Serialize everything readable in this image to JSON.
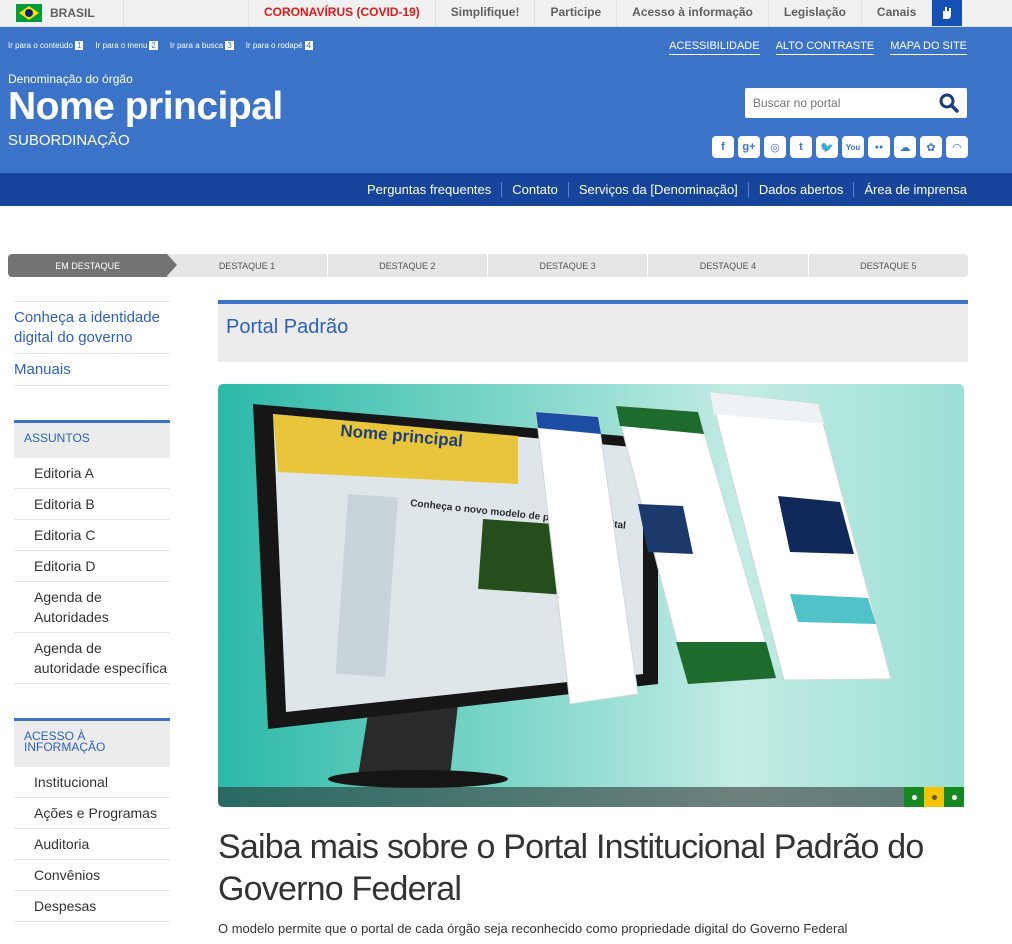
{
  "govbar": {
    "country": "BRASIL",
    "links": [
      "CORONAVÍRUS (COVID-19)",
      "Simplifique!",
      "Participe",
      "Acesso à informação",
      "Legislação",
      "Canais"
    ]
  },
  "access_links": [
    {
      "label": "Ir para o conteúdo",
      "key": "1"
    },
    {
      "label": "Ir para o menu",
      "key": "2"
    },
    {
      "label": "Ir para a busca",
      "key": "3"
    },
    {
      "label": "Ir para o rodapé",
      "key": "4"
    }
  ],
  "tools": [
    "ACESSIBILIDADE",
    "ALTO CONTRASTE",
    "MAPA DO SITE"
  ],
  "header": {
    "denomination": "Denominação do órgão",
    "title": "Nome principal",
    "subordination": "SUBORDINAÇÃO"
  },
  "search": {
    "placeholder": "Buscar no portal"
  },
  "social": [
    "facebook-icon",
    "google-plus-icon",
    "instagram-icon",
    "tumblr-icon",
    "twitter-icon",
    "youtube-icon",
    "flickr-icon",
    "soundcloud-icon",
    "slideshare-icon",
    "rss-icon"
  ],
  "social_glyphs": [
    "f",
    "g+",
    "◎",
    "t",
    "🐦",
    "You",
    "●●",
    "☁",
    "✿",
    "◠"
  ],
  "nav": [
    "Perguntas frequentes",
    "Contato",
    "Serviços da [Denominação]",
    "Dados abertos",
    "Área de imprensa"
  ],
  "highlights": [
    "EM DESTAQUE",
    "DESTAQUE 1",
    "DESTAQUE 2",
    "DESTAQUE 3",
    "DESTAQUE 4",
    "DESTAQUE 5"
  ],
  "sidebar": {
    "top_links": [
      "Conheça a identidade digital do governo",
      "Manuais"
    ],
    "sections": [
      {
        "title": "ASSUNTOS",
        "items": [
          "Editoria A",
          "Editoria B",
          "Editoria C",
          "Editoria D",
          "Agenda de Autoridades",
          "Agenda de autoridade específica"
        ]
      },
      {
        "title": "ACESSO À INFORMAÇÃO",
        "items": [
          "Institucional",
          "Ações e Programas",
          "Auditoria",
          "Convênios",
          "Despesas"
        ]
      }
    ]
  },
  "main": {
    "page_title": "Portal Padrão",
    "headline": "Saiba mais sobre o Portal Institucional Padrão do Governo Federal",
    "description": "O modelo permite que o portal de cada órgão seja reconhecido como propriedade digital do Governo Federal"
  },
  "hero": {
    "screen_title": "Nome principal",
    "screen_heading": "Conheça o novo modelo de plataforma digital"
  },
  "colors": {
    "header_blue": "#3b73c8",
    "nav_blue": "#17459c",
    "link_blue": "#2d61b7",
    "covid_red": "#dc1a1a",
    "carousel_green": "#168821",
    "carousel_yellow": "#f6c300"
  }
}
